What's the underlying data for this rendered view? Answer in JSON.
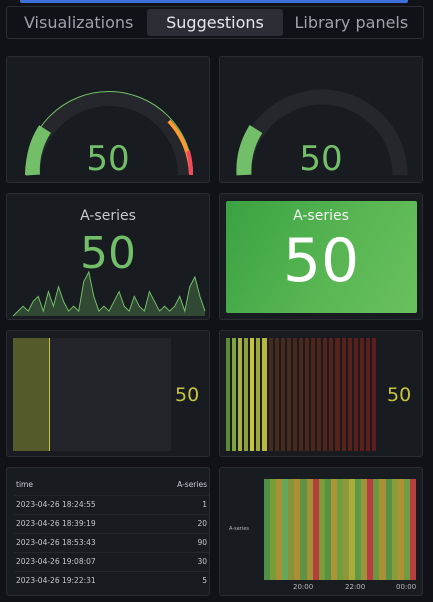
{
  "tabs": [
    {
      "label": "Visualizations"
    },
    {
      "label": "Suggestions"
    },
    {
      "label": "Library panels"
    }
  ],
  "gauge1": {
    "value": "50"
  },
  "gauge2": {
    "value": "50"
  },
  "stat1": {
    "title": "A-series",
    "value": "50"
  },
  "stat2": {
    "title": "A-series",
    "value": "50"
  },
  "bargauge1": {
    "value": "50"
  },
  "bargauge2": {
    "value": "50"
  },
  "table": {
    "columns": [
      "time",
      "A-series"
    ],
    "rows": [
      [
        "2023-04-26 18:24:55",
        "1"
      ],
      [
        "2023-04-26 18:39:19",
        "20"
      ],
      [
        "2023-04-26 18:53:43",
        "90"
      ],
      [
        "2023-04-26 19:08:07",
        "30"
      ],
      [
        "2023-04-26 19:22:31",
        "5"
      ]
    ]
  },
  "heatmap": {
    "series_label": "A-series",
    "ticks": [
      "20:00",
      "22:00",
      "00:00"
    ]
  },
  "chart_data": {
    "type": "area",
    "values": [
      0,
      1,
      2,
      1,
      3,
      4,
      1,
      5,
      2,
      6,
      3,
      1,
      2,
      1,
      7,
      9,
      4,
      1,
      2,
      1,
      3,
      5,
      2,
      1,
      4,
      2,
      1,
      5,
      3,
      1,
      2,
      1,
      2,
      4,
      1,
      6,
      8,
      4,
      1
    ]
  },
  "colors": {
    "green": "#73bf69",
    "gauge_track": "#25272c",
    "orange": "#ff9830",
    "red": "#f2495c",
    "yellow": "#c6c43e",
    "panel_bg": "#181b1f"
  }
}
